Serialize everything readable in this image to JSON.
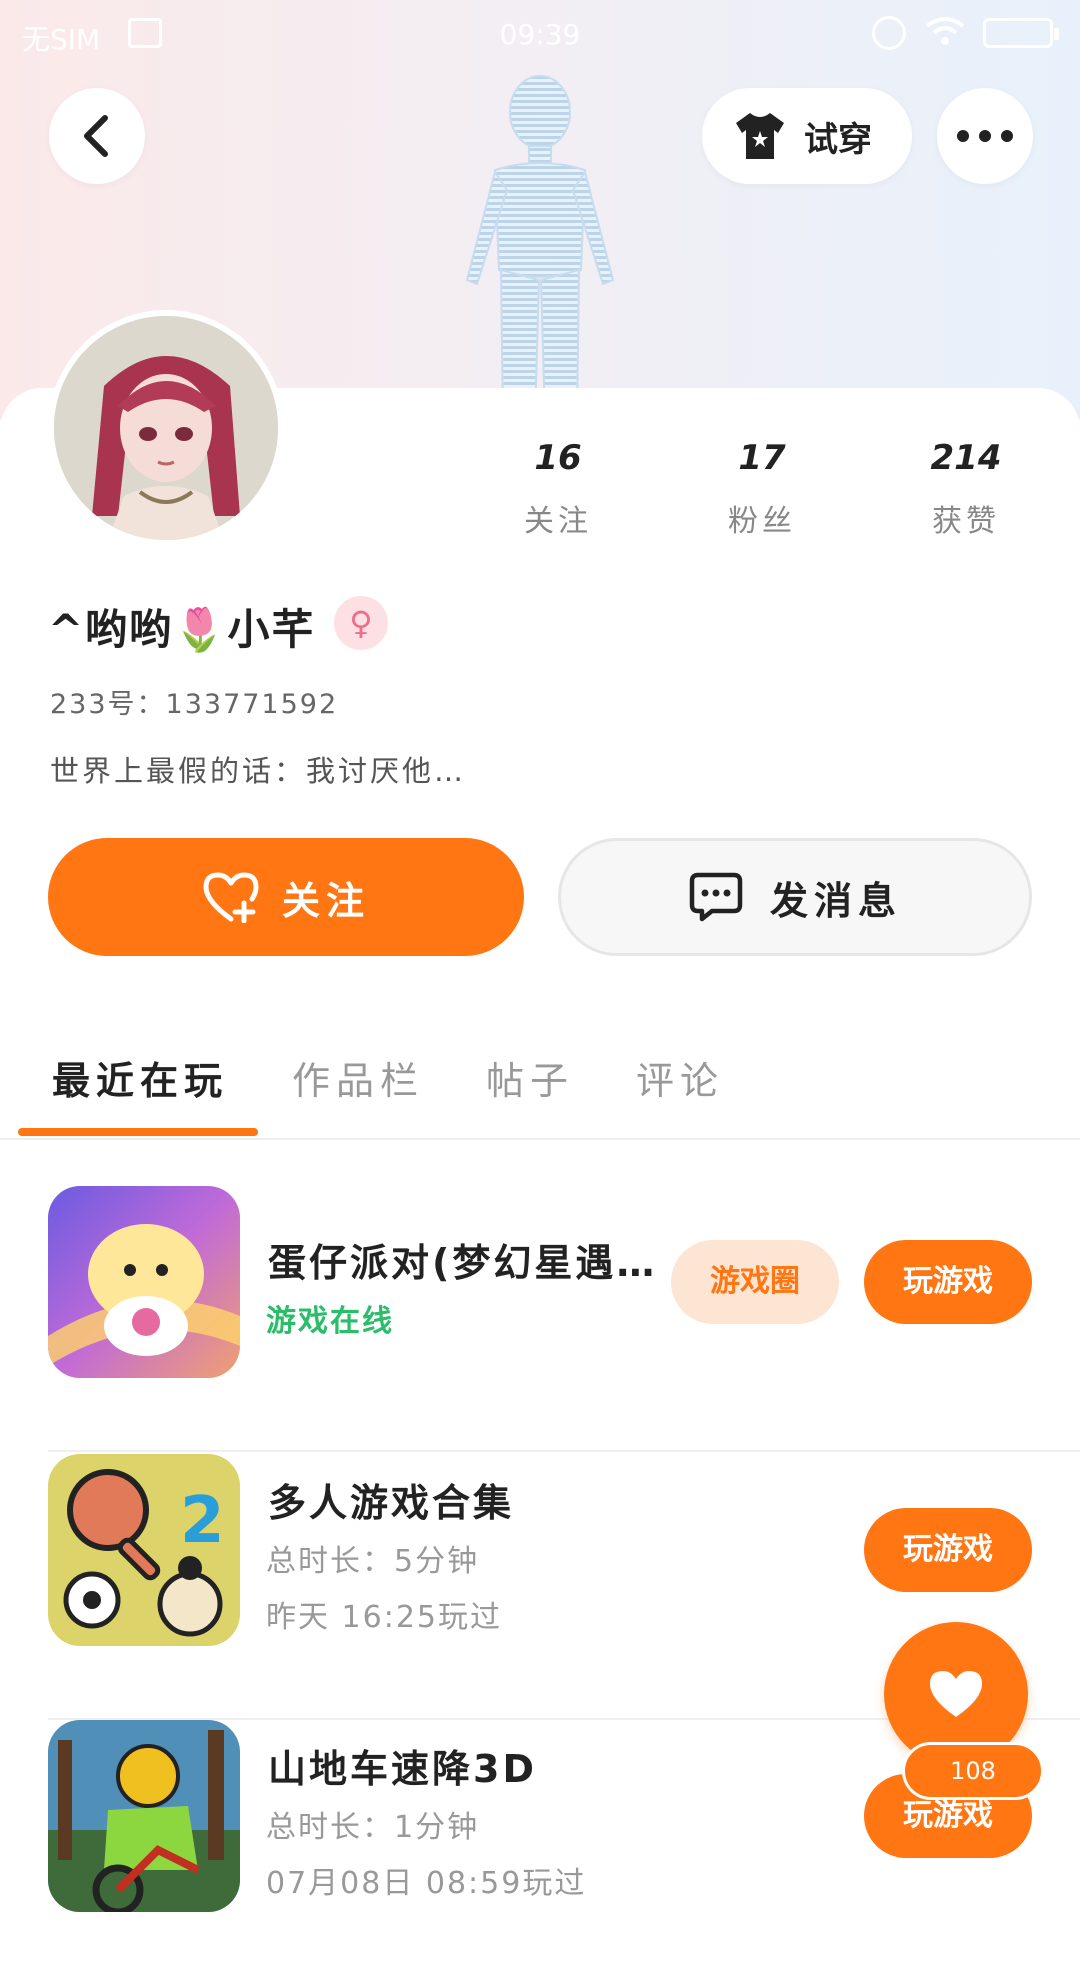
{
  "status_bar": {
    "sim": "无SIM",
    "time": "09:39"
  },
  "header": {
    "tryon_label": "试穿"
  },
  "profile": {
    "stats": [
      {
        "value": "16",
        "label": "关注"
      },
      {
        "value": "17",
        "label": "粉丝"
      },
      {
        "value": "214",
        "label": "获赞"
      }
    ],
    "username": "^哟哟🌷小芊",
    "gender_symbol": "♀",
    "uid": "233号：133771592",
    "bio": "世界上最假的话：我讨厌他…"
  },
  "actions": {
    "follow_label": "关注",
    "message_label": "发消息"
  },
  "tabs": [
    {
      "label": "最近在玩",
      "active": true
    },
    {
      "label": "作品栏",
      "active": false
    },
    {
      "label": "帖子",
      "active": false
    },
    {
      "label": "评论",
      "active": false
    }
  ],
  "games": [
    {
      "title": "蛋仔派对(梦幻星遇…",
      "status": "游戏在线",
      "circle_label": "游戏圈",
      "play_label": "玩游戏"
    },
    {
      "title": "多人游戏合集",
      "duration": "总时长：5分钟",
      "last_played": "昨天 16:25玩过",
      "play_label": "玩游戏"
    },
    {
      "title": "山地车速降3D",
      "duration": "总时长：1分钟",
      "last_played": "07月08日 08:59玩过",
      "play_label": "玩游戏"
    }
  ],
  "like_fab": {
    "count": "108"
  },
  "colors": {
    "accent": "#ff7613",
    "online": "#2cbd6a",
    "circle_bg": "#fde5d4"
  }
}
